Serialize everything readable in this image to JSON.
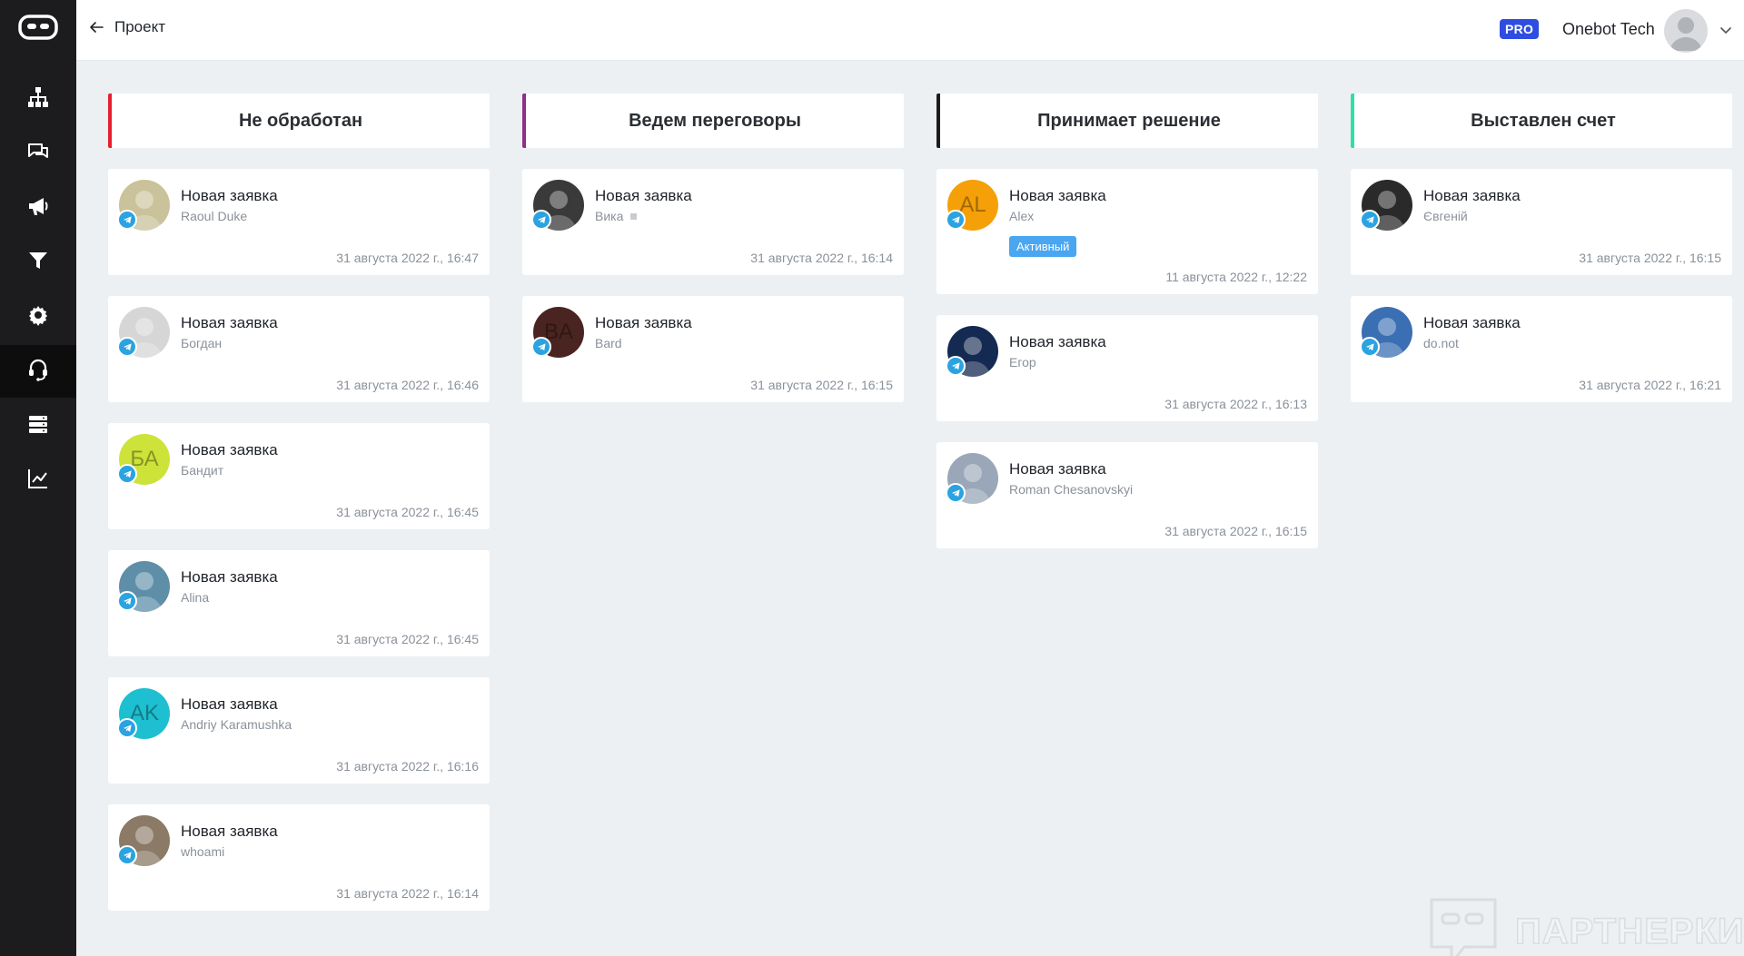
{
  "header": {
    "back_label": "Проект",
    "plan_badge": "PRO",
    "org_name": "Onebot Tech"
  },
  "sidebar": {
    "items": [
      {
        "icon": "structure-icon"
      },
      {
        "icon": "chat-icon"
      },
      {
        "icon": "megaphone-icon"
      },
      {
        "icon": "filter-icon"
      },
      {
        "icon": "gear-icon"
      },
      {
        "icon": "support-headset-icon",
        "active": true
      },
      {
        "icon": "database-icon"
      },
      {
        "icon": "analytics-icon"
      }
    ]
  },
  "columns": [
    {
      "title": "Не обработан",
      "accent": "#e5202e",
      "cards": [
        {
          "title": "Новая заявка",
          "name": "Raoul Duke",
          "date": "31 августа 2022 г., 16:47",
          "avatar_color": "#c9c29a"
        },
        {
          "title": "Новая заявка",
          "name": "Богдан",
          "date": "31 августа 2022 г., 16:46",
          "avatar_color": "#d6d6d6"
        },
        {
          "title": "Новая заявка",
          "name": "Бандит",
          "date": "31 августа 2022 г., 16:45",
          "avatar_initials": "БА",
          "avatar_color": "#cde33a"
        },
        {
          "title": "Новая заявка",
          "name": "Alina",
          "date": "31 августа 2022 г., 16:45",
          "avatar_color": "#5f8fa8"
        },
        {
          "title": "Новая заявка",
          "name": "Andriy Karamushka",
          "date": "31 августа 2022 г., 16:16",
          "avatar_initials": "AK",
          "avatar_color": "#1dbfd0"
        },
        {
          "title": "Новая заявка",
          "name": "whoami",
          "date": "31 августа 2022 г., 16:14",
          "avatar_color": "#8a7a66"
        }
      ]
    },
    {
      "title": "Ведем переговоры",
      "accent": "#8e2f8a",
      "cards": [
        {
          "title": "Новая заявка",
          "name": "Вика",
          "date": "31 августа 2022 г., 16:14",
          "avatar_color": "#3a3a3a",
          "name_marker": true
        },
        {
          "title": "Новая заявка",
          "name": "Bard",
          "date": "31 августа 2022 г., 16:15",
          "avatar_initials": "BA",
          "avatar_color": "#4a2420"
        }
      ]
    },
    {
      "title": "Принимает решение",
      "accent": "#1c1c1e",
      "cards": [
        {
          "title": "Новая заявка",
          "name": "Alex",
          "date": "11 августа 2022 г., 12:22",
          "avatar_initials": "AL",
          "avatar_color": "#f5a009",
          "status": "Активный"
        },
        {
          "title": "Новая заявка",
          "name": "Егор",
          "date": "31 августа 2022 г., 16:13",
          "avatar_color": "#152a52"
        },
        {
          "title": "Новая заявка",
          "name": "Roman Chesanovskyi",
          "date": "31 августа 2022 г., 16:15",
          "avatar_color": "#9aa7b8"
        }
      ]
    },
    {
      "title": "Выставлен счет",
      "accent": "#2ee0a0",
      "cards": [
        {
          "title": "Новая заявка",
          "name": "Євгеній",
          "date": "31 августа 2022 г., 16:15",
          "avatar_color": "#2a2a2a"
        },
        {
          "title": "Новая заявка",
          "name": "do.not",
          "date": "31 августа 2022 г., 16:21",
          "avatar_color": "#3b6fb3"
        }
      ]
    }
  ],
  "watermark": "ПАРТНЕРКИН"
}
